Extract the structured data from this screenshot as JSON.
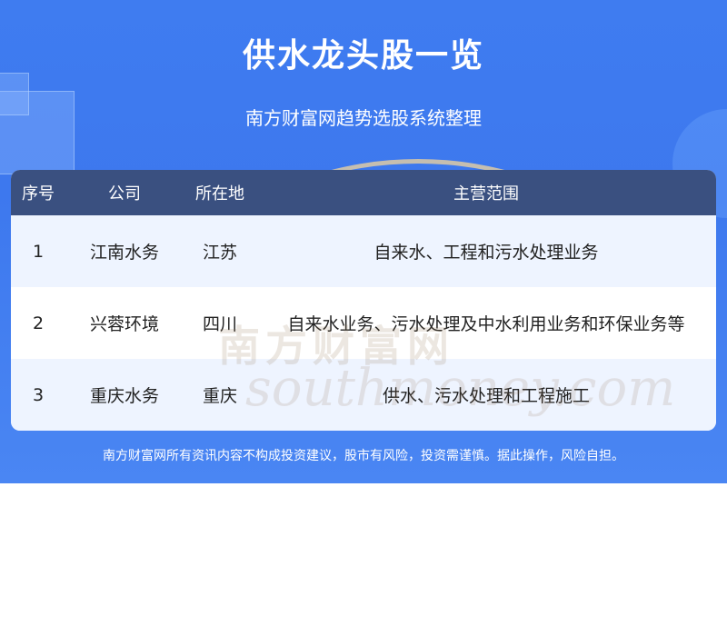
{
  "header": {
    "title": "供水龙头股一览",
    "subtitle": "南方财富网趋势选股系统整理"
  },
  "table": {
    "columns": [
      "序号",
      "公司",
      "所在地",
      "主营范围"
    ],
    "rows": [
      {
        "no": "1",
        "company": "江南水务",
        "location": "江苏",
        "business": "自来水、工程和污水处理业务"
      },
      {
        "no": "2",
        "company": "兴蓉环境",
        "location": "四川",
        "business": "自来水业务、污水处理及中水利用业务和环保业务等"
      },
      {
        "no": "3",
        "company": "重庆水务",
        "location": "重庆",
        "business": "供水、污水处理和工程施工"
      }
    ]
  },
  "watermark": {
    "cn": "南方财富网",
    "en": "southmoney.com"
  },
  "footer": {
    "disclaimer": "南方财富网所有资讯内容不构成投资建议，股市有风险，投资需谨慎。据此操作，风险自担。"
  },
  "colors": {
    "banner": "#3f7cf0",
    "table_header": "#3a5080",
    "row_alt": "#eef4ff"
  }
}
